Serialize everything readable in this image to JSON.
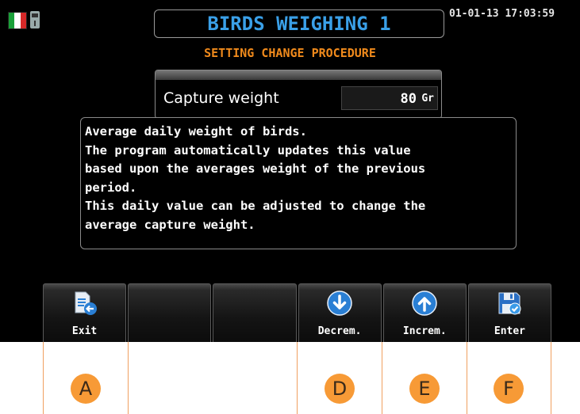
{
  "header": {
    "title": "BIRDS WEIGHING 1",
    "datetime": "01-01-13  17:03:59",
    "subtitle": "SETTING CHANGE PROCEDURE",
    "status_icons": [
      "italian-flag-icon",
      "usb-icon"
    ]
  },
  "parameter": {
    "label": "Capture weight",
    "value": "80",
    "unit": "Gr"
  },
  "description": {
    "lines": [
      "Average daily weight of birds.",
      "The program automatically updates this value",
      "based upon the averages weight of the previous",
      "period.",
      "This daily value can be adjusted to change the",
      "average capture weight."
    ]
  },
  "toolbar": {
    "keys": [
      {
        "label": "Exit",
        "icon": "exit-icon"
      },
      {
        "label": "",
        "icon": ""
      },
      {
        "label": "",
        "icon": ""
      },
      {
        "label": "Decrem.",
        "icon": "arrow-down-icon"
      },
      {
        "label": "Increm.",
        "icon": "arrow-up-icon"
      },
      {
        "label": "Enter",
        "icon": "save-icon"
      }
    ]
  },
  "callouts": [
    "A",
    "D",
    "E",
    "F"
  ],
  "colors": {
    "title": "#3aa0e8",
    "subtitle": "#f08a1c",
    "callout": "#f79a36",
    "icon_blue": "#2a7fd4"
  }
}
